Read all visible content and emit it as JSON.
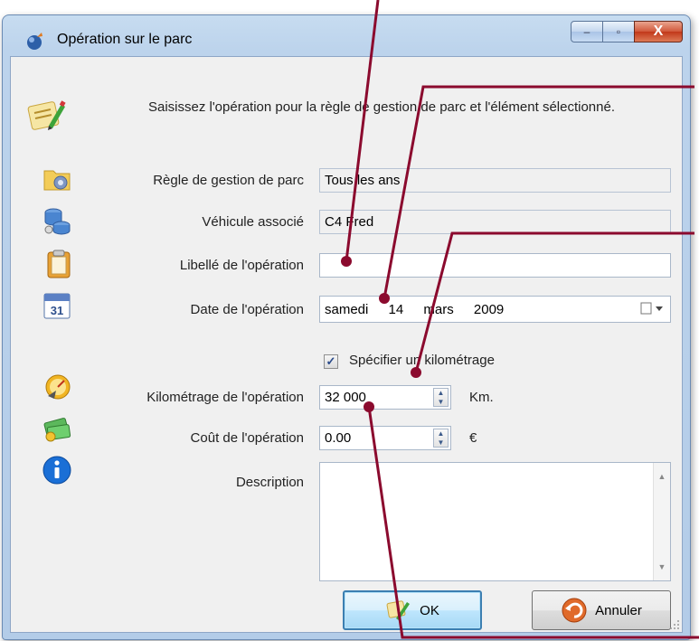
{
  "window": {
    "title": "Opération sur le parc",
    "buttons": {
      "minimize": "–",
      "maximize": "▫",
      "close": "X"
    }
  },
  "instruction": "Saisissez l'opération pour la règle de gestion de parc et l'élément sélectionné.",
  "form": {
    "rule": {
      "label": "Règle de gestion de parc",
      "value": "Tous les ans",
      "icon": "settings-folder-icon"
    },
    "vehicle": {
      "label": "Véhicule associé",
      "value": "C4 Fred",
      "icon": "database-icon"
    },
    "operation_label": {
      "label": "Libellé de l'opération",
      "value": "",
      "icon": "clipboard-icon"
    },
    "date": {
      "label": "Date de l'opération",
      "weekday": "samedi",
      "day": "14",
      "month": "mars",
      "year": "2009",
      "icon": "calendar-icon",
      "calendar_icon_text": "31"
    },
    "specify_mileage": {
      "label": "Spécifier un kilométrage",
      "checked": true,
      "check_glyph": "✓"
    },
    "mileage": {
      "label": "Kilométrage de l'opération",
      "value": "32 000",
      "unit": "Km.",
      "icon": "gauge-icon"
    },
    "cost": {
      "label": "Coût de l'opération",
      "value": "0.00",
      "unit": "€",
      "icon": "money-icon"
    },
    "description": {
      "label": "Description",
      "value": "",
      "icon": "info-icon"
    }
  },
  "buttons": {
    "ok": "OK",
    "cancel": "Annuler"
  },
  "colors": {
    "callout": "#8b0a2e",
    "accent": "#3c7fb1"
  }
}
